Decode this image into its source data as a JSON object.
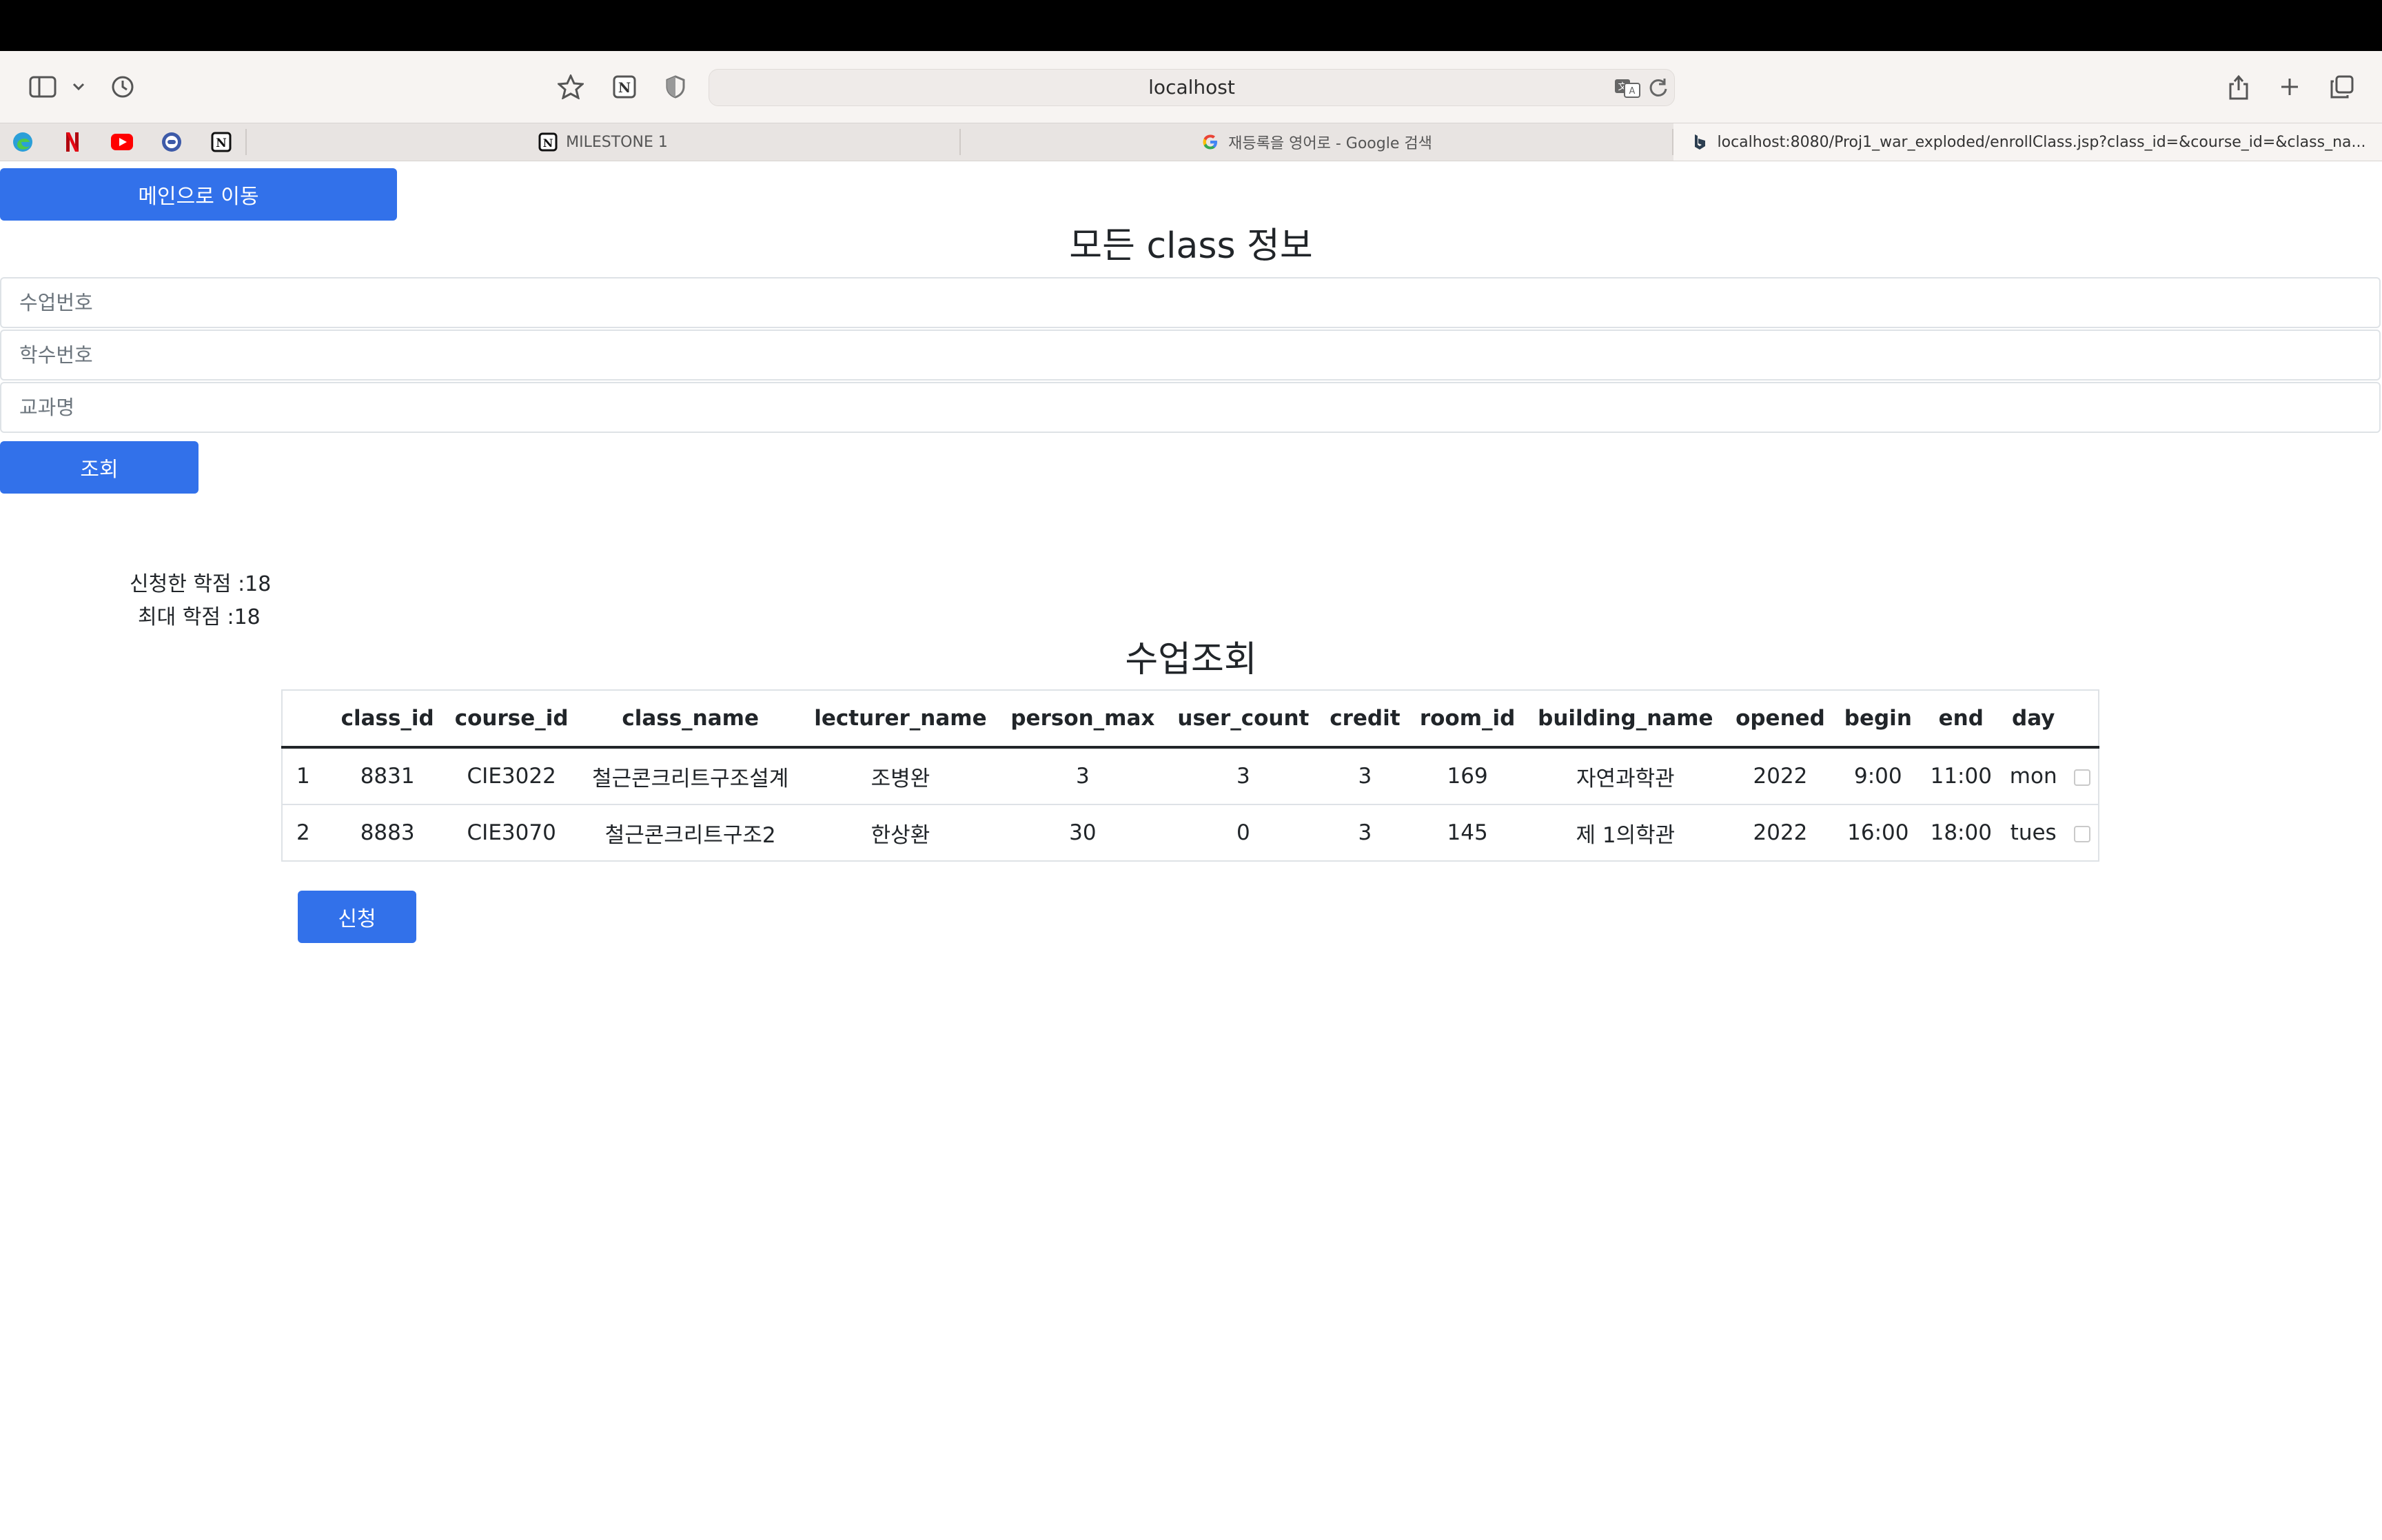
{
  "browser": {
    "url": "localhost",
    "tabs": [
      {
        "label": "MILESTONE 1",
        "favicon": "notion-icon",
        "active": false
      },
      {
        "label": "재등록을 영어로 - Google 검색",
        "favicon": "google-icon",
        "active": false
      },
      {
        "label": "localhost:8080/Proj1_war_exploded/enrollClass.jsp?class_id=&course_id=&class_na...",
        "favicon": "site-icon",
        "active": true
      }
    ],
    "bookmarks": [
      "edge-icon",
      "netflix-icon",
      "youtube-icon",
      "chat-icon",
      "notion-icon"
    ]
  },
  "page": {
    "main_button": "메인으로 이동",
    "title": "모든 class 정보",
    "search": {
      "class_placeholder": "수업번호",
      "course_placeholder": "학수번호",
      "name_placeholder": "교과명",
      "submit": "조회"
    },
    "credits": {
      "applied": "신청한 학점 :18",
      "max": "최대 학점 :18"
    },
    "table_title": "수업조회",
    "columns": [
      "",
      "class_id",
      "course_id",
      "class_name",
      "lecturer_name",
      "person_max",
      "user_count",
      "credit",
      "room_id",
      "building_name",
      "opened",
      "begin",
      "end",
      "day",
      ""
    ],
    "rows": [
      [
        "1",
        "8831",
        "CIE3022",
        "철근콘크리트구조설계",
        "조병완",
        "3",
        "3",
        "3",
        "169",
        "자연과학관",
        "2022",
        "9:00",
        "11:00",
        "mon"
      ],
      [
        "2",
        "8883",
        "CIE3070",
        "철근콘크리트구조2",
        "한상환",
        "30",
        "0",
        "3",
        "145",
        "제 1의학관",
        "2022",
        "16:00",
        "18:00",
        "tues"
      ]
    ],
    "enroll_button": "신청"
  },
  "colors": {
    "primary": "#3271ea",
    "toolbar": "#f7f4f2"
  }
}
